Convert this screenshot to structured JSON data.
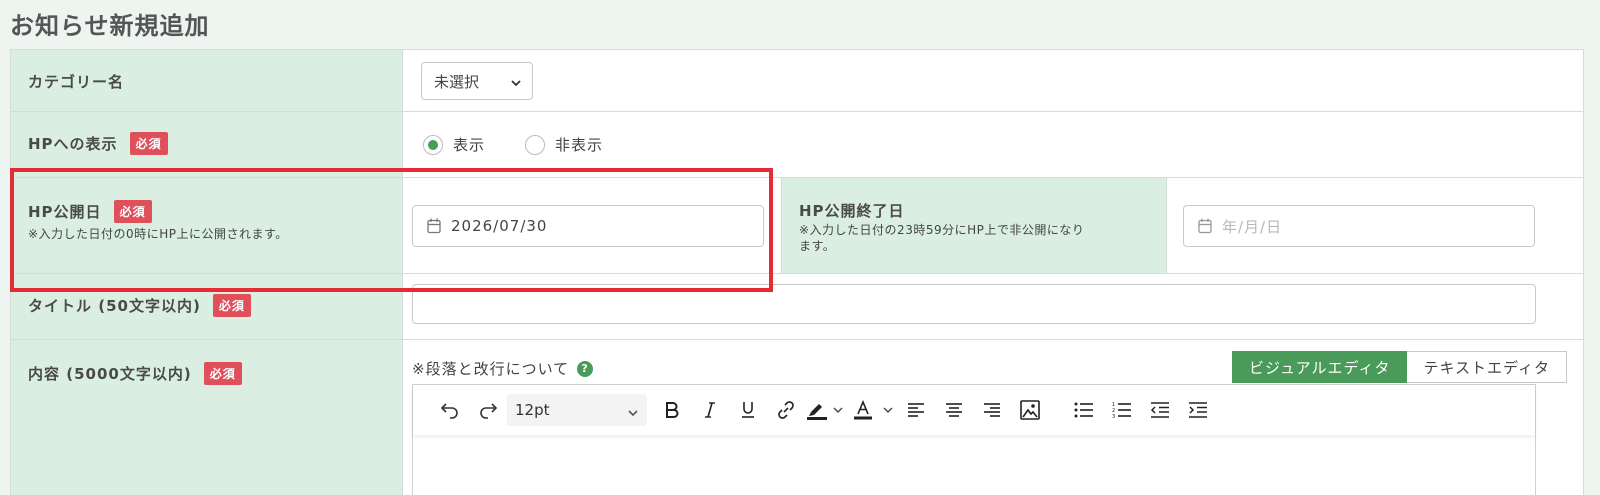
{
  "page": {
    "title": "お知らせ新規追加"
  },
  "form": {
    "category": {
      "label": "カテゴリー名",
      "select_value": "未選択"
    },
    "hp_display": {
      "label": "HPへの表示",
      "required": "必須",
      "options": [
        {
          "label": "表示",
          "checked": true
        },
        {
          "label": "非表示",
          "checked": false
        }
      ]
    },
    "publish_date": {
      "label": "HP公開日",
      "required": "必須",
      "note": "※入力した日付の0時にHP上に公開されます。",
      "value": "2026/07/30"
    },
    "publish_end_date": {
      "label": "HP公開終了日",
      "note": "※入力した日付の23時59分にHP上で非公開になります。",
      "note_line1": "※入力した日付の23時59分にHP上で非公開になり",
      "note_line2": "ます。",
      "placeholder": "年/月/日"
    },
    "title": {
      "label": "タイトル (50文字以内)",
      "required": "必須",
      "value": ""
    },
    "content": {
      "label": "内容 (5000文字以内)",
      "required": "必須",
      "help_text": "※段落と改行について",
      "help_icon": "?",
      "tabs": [
        {
          "label": "ビジュアルエディタ",
          "active": true
        },
        {
          "label": "テキストエディタ",
          "active": false
        }
      ],
      "toolbar": {
        "font_size": "12pt",
        "icons": [
          "undo-icon",
          "redo-icon",
          "bold-icon",
          "italic-icon",
          "underline-icon",
          "link-icon",
          "highlight-icon",
          "text-color-icon",
          "align-left-icon",
          "align-center-icon",
          "align-right-icon",
          "image-icon",
          "bullet-list-icon",
          "numbered-list-icon",
          "outdent-icon",
          "indent-icon"
        ]
      }
    }
  },
  "colors": {
    "accent_green": "#4a9a5a",
    "label_bg": "#daeee1",
    "required_red": "#e0505a",
    "highlight_red": "#e52b34"
  }
}
